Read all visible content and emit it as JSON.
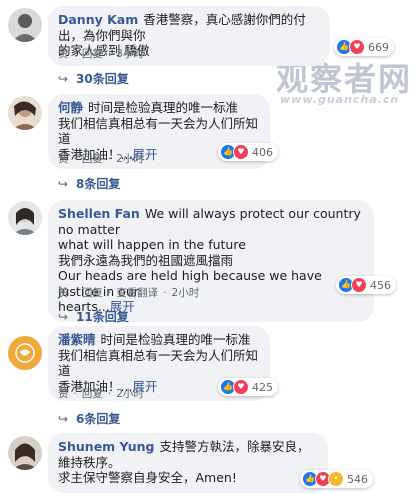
{
  "watermark": {
    "title": "观察者网",
    "url": "www.guancha.cn"
  },
  "comments": [
    {
      "name": "Danny Kam",
      "lines": [
        "香港警察，真心感謝你們的付出，為你們與你",
        "的家人感到 驕傲"
      ],
      "more": "",
      "actions": {
        "like": "赞",
        "reply": "回复",
        "time": "3小时"
      },
      "reaction_count": "669",
      "replies": "30条回复",
      "avatar_color": "#6b6b6b"
    },
    {
      "name": "何静",
      "lines": [
        "时间是检验真理的唯一标准",
        "我们相信真相总有一天会为人们所知道",
        "香港加油！..."
      ],
      "more": "展开",
      "actions": {
        "like": "赞",
        "reply": "回复",
        "time": "2小时"
      },
      "reaction_count": "406",
      "replies": "8条回复",
      "avatar_color": "#8a6a58"
    },
    {
      "name": "Shellen Fan",
      "lines": [
        "We will always protect our country no matter",
        "what will happen in the future",
        "我們永遠為我們的祖國遮風擋雨",
        "Our heads are held high because we have justice in our",
        "hearts..."
      ],
      "more": "展开",
      "actions": {
        "like": "赞",
        "reply": "回复",
        "translate": "查看翻译",
        "time": "2小时"
      },
      "reaction_count": "456",
      "replies": "11条回复",
      "avatar_color": "#7a7f86"
    },
    {
      "name": "潘紫晴",
      "lines": [
        "时间是检验真理的唯一标准",
        "我们相信真相总有一天会为人们所知道",
        "香港加油！..."
      ],
      "more": "展开",
      "actions": {
        "like": "赞",
        "reply": "回复",
        "time": "2小时"
      },
      "reaction_count": "425",
      "replies": "6条回复",
      "avatar_color": "#f2a93b"
    },
    {
      "name": "Shunem Yung",
      "lines": [
        "支持警方執法，除暴安良，維持秩序。",
        "求主保守警察自身安全，Amen!"
      ],
      "more": "",
      "actions": {
        "like": "赞",
        "reply": "回复",
        "time": "2小时"
      },
      "reaction_count": "546",
      "replies": "",
      "avatar_color": "#5b4a3e"
    }
  ]
}
